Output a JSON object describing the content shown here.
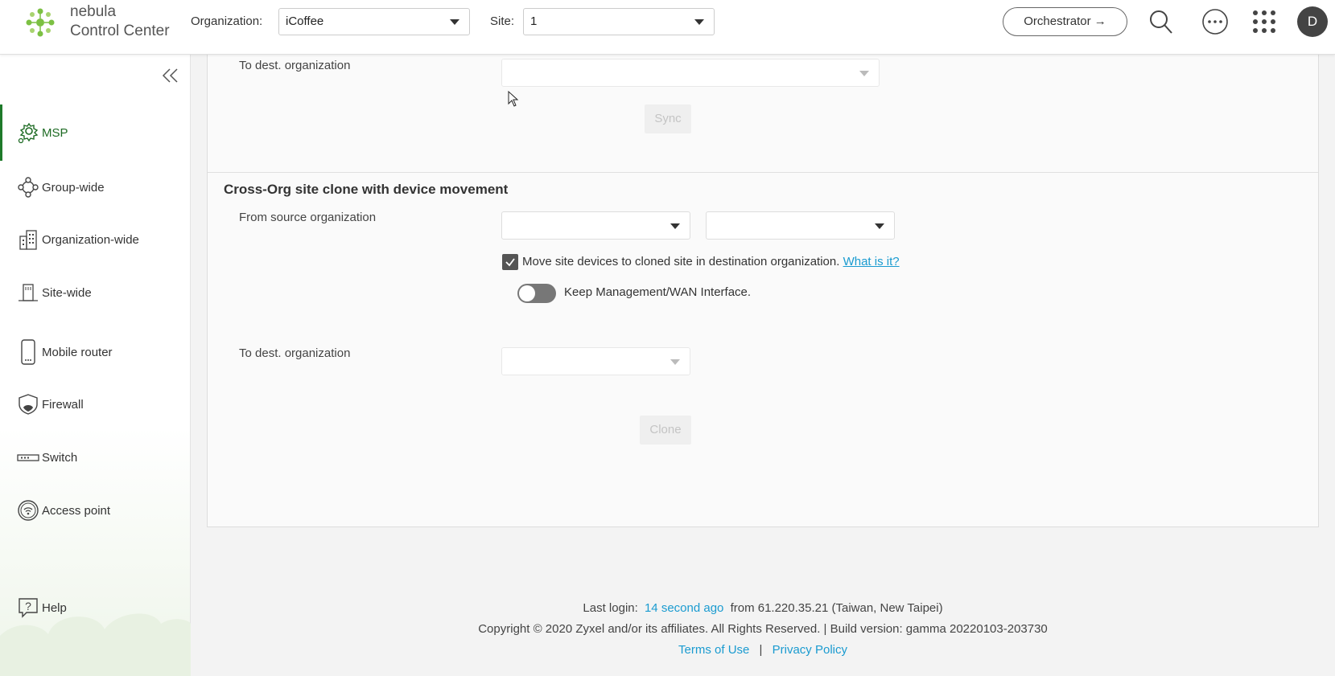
{
  "header": {
    "brand_line1": "nebula",
    "brand_line2": "Control Center",
    "org_label": "Organization:",
    "org_value": "iCoffee",
    "site_label": "Site:",
    "site_value": "1",
    "orchestrator_label": "Orchestrator →",
    "avatar_initial": "D"
  },
  "sidebar": {
    "items": [
      {
        "label": "MSP"
      },
      {
        "label": "Group-wide"
      },
      {
        "label": "Organization-wide"
      },
      {
        "label": "Site-wide"
      },
      {
        "label": "Mobile router"
      },
      {
        "label": "Firewall"
      },
      {
        "label": "Switch"
      },
      {
        "label": "Access point"
      }
    ],
    "help_label": "Help"
  },
  "sync_section": {
    "dest_label": "To dest. organization",
    "dest_value": "",
    "sync_button": "Sync"
  },
  "clone_section": {
    "title": "Cross-Org site clone with device movement",
    "source_label": "From source organization",
    "source_org_value": "",
    "source_site_value": "",
    "move_devices_label": "Move site devices to cloned site in destination organization.",
    "move_devices_checked": true,
    "what_is_it_link": "What is it?",
    "keep_mgmt_label": "Keep Management/WAN Interface.",
    "keep_mgmt_on": false,
    "dest_label": "To dest. organization",
    "dest_value": "",
    "clone_button": "Clone"
  },
  "footer": {
    "last_login_prefix": "Last login:",
    "last_login_time": "14 second ago",
    "last_login_suffix": "from 61.220.35.21 (Taiwan, New Taipei)",
    "copyright": "Copyright © 2020 Zyxel and/or its affiliates. All Rights Reserved. | Build version: gamma 20220103-203730",
    "terms_link": "Terms of Use",
    "separator": "|",
    "privacy_link": "Privacy Policy"
  },
  "colors": {
    "accent_green": "#1e7a2a",
    "link_blue": "#1a9bd0"
  }
}
